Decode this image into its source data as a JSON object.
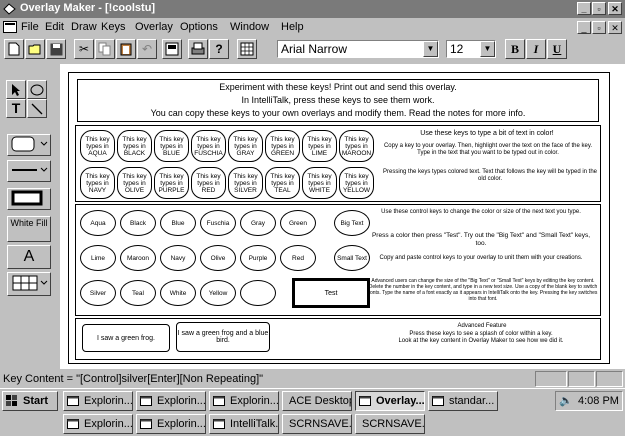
{
  "window": {
    "title": "Overlay Maker - [!coolstu]"
  },
  "menu": [
    "File",
    "Edit",
    "Draw",
    "Keys",
    "Overlay",
    "Options",
    "Window",
    "Help"
  ],
  "toolbar": {
    "font": "Arial Narrow",
    "size": "12",
    "bold": "B",
    "italic": "I",
    "underline": "U"
  },
  "tools": {
    "white_fill": "White Fill",
    "text_tool": "A"
  },
  "overlay": {
    "header": {
      "line1": "Experiment with these keys! Print out and send this overlay.",
      "line2": "In IntelliTalk, press these keys to see them work.",
      "line3": "You can copy these keys to your own overlays and modify them. Read the notes for more info."
    },
    "color_keys": [
      "This key types in AQUA",
      "This key types in BLACK",
      "This key types in BLUE",
      "This key types in FUSCHIA",
      "This key types in GRAY",
      "This key types in GREEN",
      "This key types in LIME",
      "This key types in MAROON",
      "This key types in NAVY",
      "This key types in OLIVE",
      "This key types in PURPLE",
      "This key types in RED",
      "This key types in SILVER",
      "This key types in TEAL",
      "This key types in WHITE",
      "This key types in YELLOW"
    ],
    "color_notes": {
      "n1": "Use these keys to type a bit of text in color!",
      "n2": "Copy a key to your overlay. Then, highlight over the text on the face of the key. Type in the text that you want to be typed out in color.",
      "n3": "Pressing the keys types colored text. Text that follows the key will be typed in the old color."
    },
    "control_keys": [
      "Aqua",
      "Black",
      "Blue",
      "Fuschia",
      "Gray",
      "Green",
      "Big Text",
      "Lime",
      "Maroon",
      "Navy",
      "Olive",
      "Purple",
      "Red",
      "Small Text",
      "Silver",
      "Teal",
      "White",
      "Yellow",
      "",
      "Test"
    ],
    "control_notes": {
      "n1": "Use these control keys to change the color or size of the next text you type.",
      "n2": "Press a color then press \"Test\". Try out the \"Big Text\" and \"Small Text\" keys, too.",
      "n3": "Copy and paste control keys to your overlay to unit them with your creations.",
      "n4": "Advanced users can change the size of the \"Big Text\" or \"Small Text\" keys by editing the key content. Delete the number in the key content, and type in a new text size. Use a copy of the blank key to switch fonts. Type the name of a font exactly as it appears in IntelliTalk onto the key. Pressing the key switches into that font."
    },
    "advanced": {
      "key1": "I saw a green frog.",
      "key2": "I saw a green frog and a blue bird.",
      "title": "Advanced Feature",
      "line1": "Press these keys to see a splash of color within a key.",
      "line2": "Look at the key content in Overlay Maker to see how we did it."
    }
  },
  "status": {
    "key_content": "Key Content = \"[Control]silver[Enter][Non Repeating]\""
  },
  "taskbar": {
    "start": "Start",
    "row1": [
      "Explorin...",
      "Explorin...",
      "Explorin...",
      "ACE Desktop",
      "Overlay...",
      "standar..."
    ],
    "row2": [
      "Explorin...",
      "Explorin...",
      "IntelliTalk...",
      "SCRNSAVE...",
      "SCRNSAVE..."
    ],
    "clock": "4:08 PM"
  }
}
